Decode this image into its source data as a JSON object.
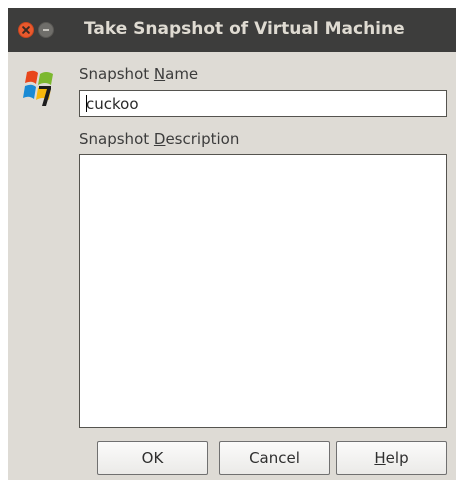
{
  "window": {
    "title": "Take Snapshot of Virtual Machine"
  },
  "form": {
    "name_label_prefix": "Snapshot ",
    "name_label_mnemonic": "N",
    "name_label_rest": "ame",
    "name_value": "cuckoo",
    "desc_label_prefix": "Snapshot ",
    "desc_label_mnemonic": "D",
    "desc_label_rest": "escription",
    "desc_value": ""
  },
  "buttons": {
    "ok": "OK",
    "cancel": "Cancel",
    "help_mnemonic": "H",
    "help_rest": "elp"
  },
  "icons": {
    "close": "close-icon",
    "minimize": "minimize-icon",
    "os": "windows-7-vm-icon"
  },
  "colors": {
    "titlebar": "#3d3d3c",
    "dialog_bg": "#dedbd5",
    "close_button": "#e9592d"
  }
}
